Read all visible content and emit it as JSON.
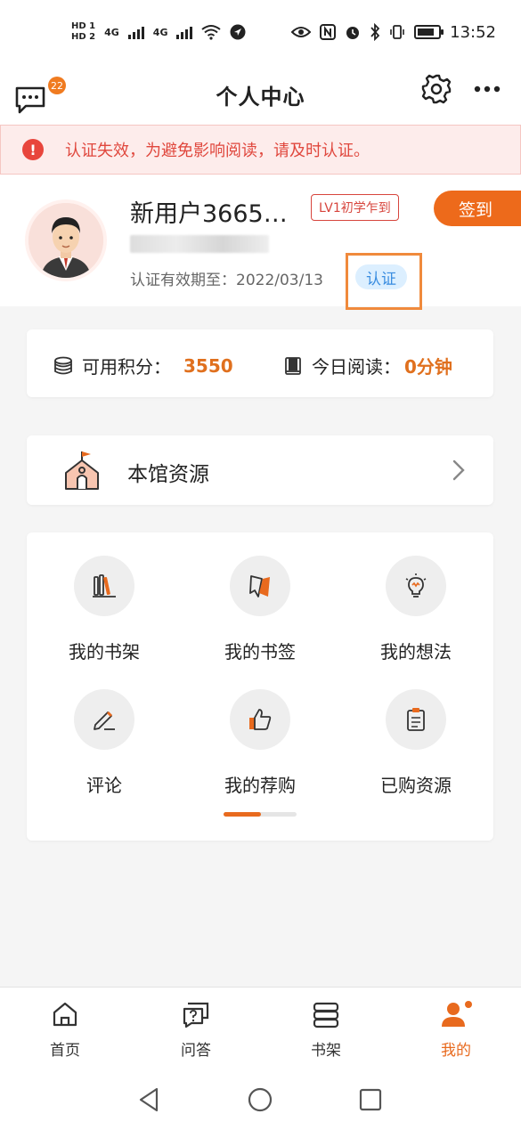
{
  "status_bar": {
    "sim1": "HD 1",
    "sim2": "HD 2",
    "net1": "4G",
    "net2": "4G",
    "time": "13:52"
  },
  "header": {
    "title": "个人中心",
    "message_badge": "22"
  },
  "warning": {
    "text": "认证失效，为避免影响阅读，请及时认证。"
  },
  "profile": {
    "username": "新用户3665…",
    "level": "LV1初学乍到",
    "signin_label": "签到",
    "expire_label": "认证有效期至：2022/03/13",
    "cert_label": "认证"
  },
  "points": {
    "available_label": "可用积分：",
    "available_value": "3550",
    "reading_label": "今日阅读：",
    "reading_value": "0分钟"
  },
  "library": {
    "label": "本馆资源"
  },
  "grid": [
    {
      "label": "我的书架",
      "icon": "books-icon"
    },
    {
      "label": "我的书签",
      "icon": "bookmark-icon"
    },
    {
      "label": "我的想法",
      "icon": "lightbulb-icon"
    },
    {
      "label": "评论",
      "icon": "pen-icon"
    },
    {
      "label": "我的荐购",
      "icon": "thumbs-up-icon"
    },
    {
      "label": "已购资源",
      "icon": "clipboard-icon"
    }
  ],
  "tabs": [
    {
      "label": "首页",
      "icon": "home-icon"
    },
    {
      "label": "问答",
      "icon": "qa-icon"
    },
    {
      "label": "书架",
      "icon": "bookshelf-icon"
    },
    {
      "label": "我的",
      "icon": "user-icon",
      "active": true
    }
  ],
  "colors": {
    "accent": "#e86a1e",
    "warning": "#e0473d",
    "cert_blue": "#3a8de0"
  }
}
